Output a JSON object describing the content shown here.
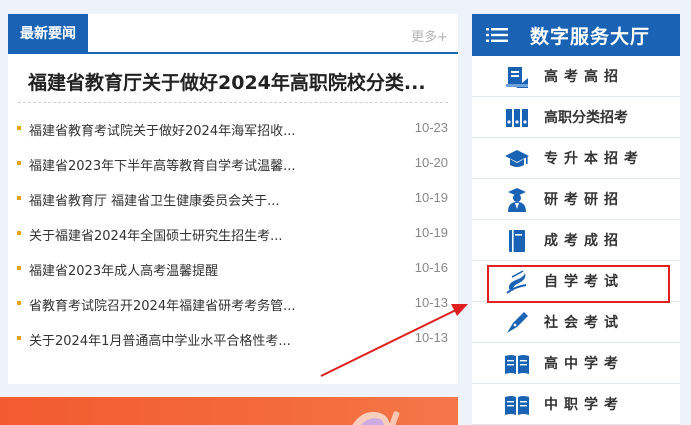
{
  "news": {
    "tab_label": "最新要闻",
    "more_label": "更多+",
    "headline": "福建省教育厅关于做好2024年高职院校分类...",
    "items": [
      {
        "title": "福建省教育考试院关于做好2024年海军招收...",
        "date": "10-23"
      },
      {
        "title": "福建省2023年下半年高等教育自学考试温馨...",
        "date": "10-20"
      },
      {
        "title": "福建省教育厅 福建省卫生健康委员会关于...",
        "date": "10-19"
      },
      {
        "title": "关于福建省2024年全国硕士研究生招生考...",
        "date": "10-19"
      },
      {
        "title": "福建省2023年成人高考温馨提醒",
        "date": "10-16"
      },
      {
        "title": "省教育考试院召开2024年福建省研考考务管...",
        "date": "10-13"
      },
      {
        "title": "关于2024年1月普通高中学业水平合格性考...",
        "date": "10-13"
      }
    ]
  },
  "hall": {
    "title": "数字服务大厅",
    "items": [
      {
        "label": "高考高招",
        "icon": "exam-paper-icon"
      },
      {
        "label": "高职分类招考",
        "icon": "binders-icon"
      },
      {
        "label": "专升本招考",
        "icon": "graduation-cap-icon"
      },
      {
        "label": "研考研招",
        "icon": "graduate-student-icon"
      },
      {
        "label": "成考成招",
        "icon": "book-icon"
      },
      {
        "label": "自学考试",
        "icon": "pen-nib-logo-icon"
      },
      {
        "label": "社会考试",
        "icon": "fountain-pen-icon"
      },
      {
        "label": "高中学考",
        "icon": "open-book-icon"
      },
      {
        "label": "中职学考",
        "icon": "open-book-icon"
      }
    ]
  },
  "colors": {
    "primary": "#1a63b4",
    "bullet": "#e8a317",
    "highlight": "#e02020",
    "banner": "#f25b2f"
  }
}
